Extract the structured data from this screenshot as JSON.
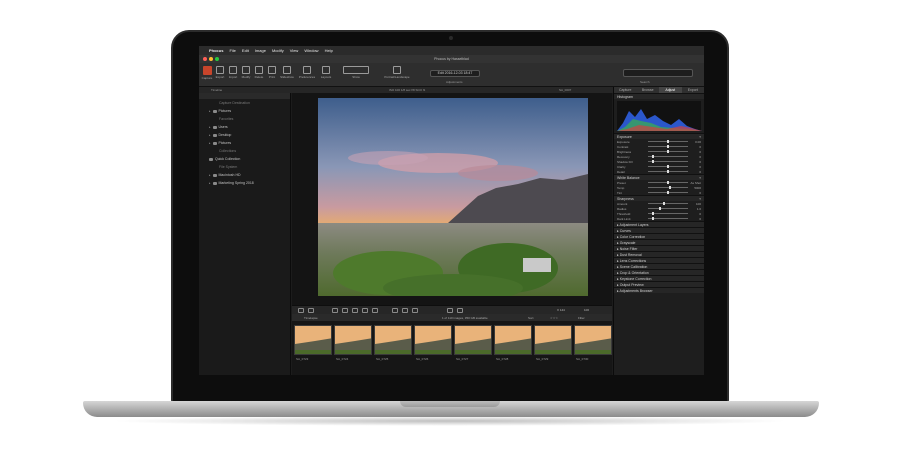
{
  "menubar": {
    "app_name": "Phocus",
    "menus": [
      "File",
      "Edit",
      "Image",
      "Modify",
      "View",
      "Window",
      "Help"
    ],
    "time": "Mon 18:20",
    "user": "Victor Hasselblad"
  },
  "window": {
    "title": "Phocus by Hasselblad"
  },
  "toolbar": {
    "labels": [
      "Capture",
      "Export",
      "Import",
      "Modify",
      "Delete",
      "Print",
      "Slideshow",
      "Preferences",
      "Layouts",
      "Show",
      "Portrait/Landscape"
    ],
    "date_field": "Edit 2016-12-03 18:47",
    "adjustments_label": "Adjustments",
    "search_label": "Search"
  },
  "subbar": {
    "left": "Timeline",
    "center": "ISO 100  1/8 sec  f/8  SCO  f1",
    "right": "SA_0007"
  },
  "left_panel": {
    "items": [
      {
        "label": "Capture Destination",
        "kind": "section"
      },
      {
        "label": "Pictures",
        "kind": "item"
      },
      {
        "label": "Favorites",
        "kind": "section"
      },
      {
        "label": "Users",
        "kind": "item"
      },
      {
        "label": "Desktop",
        "kind": "item"
      },
      {
        "label": "Pictures",
        "kind": "item"
      },
      {
        "label": "Collections",
        "kind": "section"
      },
      {
        "label": "Quick Collection",
        "kind": "item"
      },
      {
        "label": "File System",
        "kind": "section"
      },
      {
        "label": "Macintosh HD",
        "kind": "item"
      },
      {
        "label": "Marketing Spring 2018",
        "kind": "item"
      }
    ]
  },
  "viewer_bar": {
    "file_name": "X 144",
    "zoom": "100"
  },
  "browser": {
    "header": "Timelapse",
    "count": "1 of 110 images, 350 GB available",
    "sort_label": "Sort",
    "filter_label": "Filter",
    "thumbnails": [
      "SA_0723",
      "SA_0724",
      "SA_0725",
      "SA_0726",
      "SA_0727",
      "SA_0728",
      "SA_0729",
      "SA_0730"
    ]
  },
  "right_panel": {
    "tabs": [
      "Capture",
      "Browse",
      "Adjust",
      "Export"
    ],
    "active_tab": "Adjust",
    "histogram_label": "Histogram",
    "exposure_label": "Exposure",
    "exposure_sliders": [
      {
        "name": "Exposure",
        "value": "0.00",
        "pos": 0.5
      },
      {
        "name": "Contrast",
        "value": "0",
        "pos": 0.5
      },
      {
        "name": "Brightness",
        "value": "0",
        "pos": 0.5
      },
      {
        "name": "Recovery",
        "value": "0",
        "pos": 0.1
      },
      {
        "name": "Shadow Fill",
        "value": "0",
        "pos": 0.1
      },
      {
        "name": "Clarity",
        "value": "0",
        "pos": 0.5
      },
      {
        "name": "Detail",
        "value": "0",
        "pos": 0.5
      }
    ],
    "white_balance_label": "White Balance",
    "wb_sliders": [
      {
        "name": "Preset",
        "value": "As Shot",
        "pos": 0.5
      },
      {
        "name": "Temp",
        "value": "5000",
        "pos": 0.55
      },
      {
        "name": "Tint",
        "value": "0",
        "pos": 0.5
      }
    ],
    "sharpness_label": "Sharpness",
    "sharp_sliders": [
      {
        "name": "Amount",
        "value": "100",
        "pos": 0.4
      },
      {
        "name": "Radius",
        "value": "1.0",
        "pos": 0.3
      },
      {
        "name": "Threshold",
        "value": "0",
        "pos": 0.1
      },
      {
        "name": "Dark Limit",
        "value": "0",
        "pos": 0.1
      }
    ],
    "tool_list": [
      "Adjustment Layers",
      "Curves",
      "Color Correction",
      "Grayscale",
      "Noise Filter",
      "Dust Removal",
      "Lens Corrections",
      "Scene Calibration",
      "Crop & Orientation",
      "Keystone Correction",
      "Output Preview",
      "Adjustments Browser"
    ]
  },
  "colors": {
    "capture_button": "#c8452b",
    "active_tab": "#444444",
    "histogram_blue": "#2f5fe0"
  }
}
